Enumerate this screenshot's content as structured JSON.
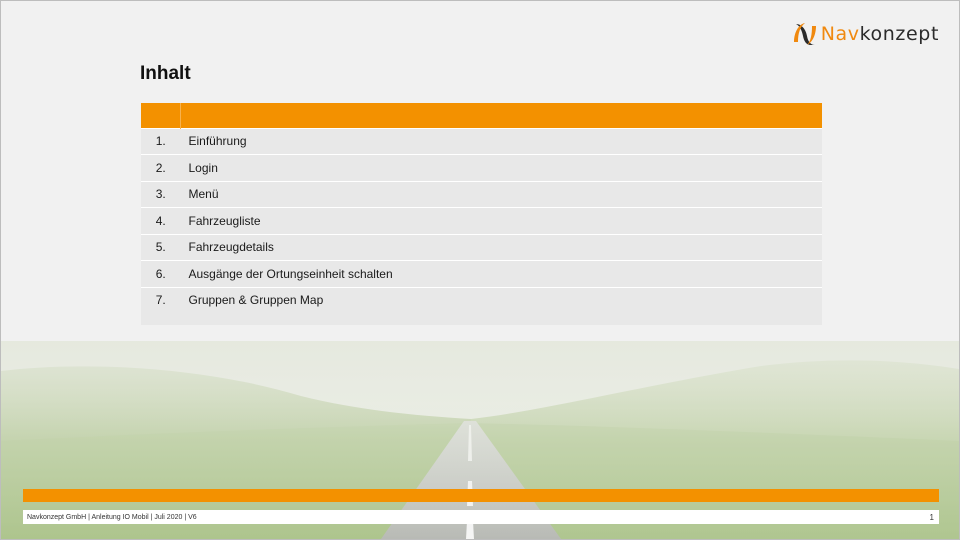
{
  "header": {
    "logo": {
      "text_part_1": "Nav",
      "text_part_2": "konzept",
      "brand_orange": "#f0890f",
      "brand_dark": "#2b2b2b",
      "icon": "navkonzept-logo-mark"
    }
  },
  "main": {
    "title": "Inhalt",
    "toc": {
      "accent_color": "#f39100",
      "items": [
        {
          "number": "1.",
          "label": "Einführung"
        },
        {
          "number": "2.",
          "label": "Login"
        },
        {
          "number": "3.",
          "label": "Menü"
        },
        {
          "number": "4.",
          "label": "Fahrzeugliste"
        },
        {
          "number": "5.",
          "label": "Fahrzeugdetails"
        },
        {
          "number": "6.",
          "label": "Ausgänge der Ortungseinheit schalten"
        },
        {
          "number": "7.",
          "label": "Gruppen & Gruppen Map"
        }
      ]
    }
  },
  "footer": {
    "text": "Navkonzept GmbH  |  Anleitung IO Mobil  |  Juli 2020  |  V6",
    "page_number": "1"
  }
}
